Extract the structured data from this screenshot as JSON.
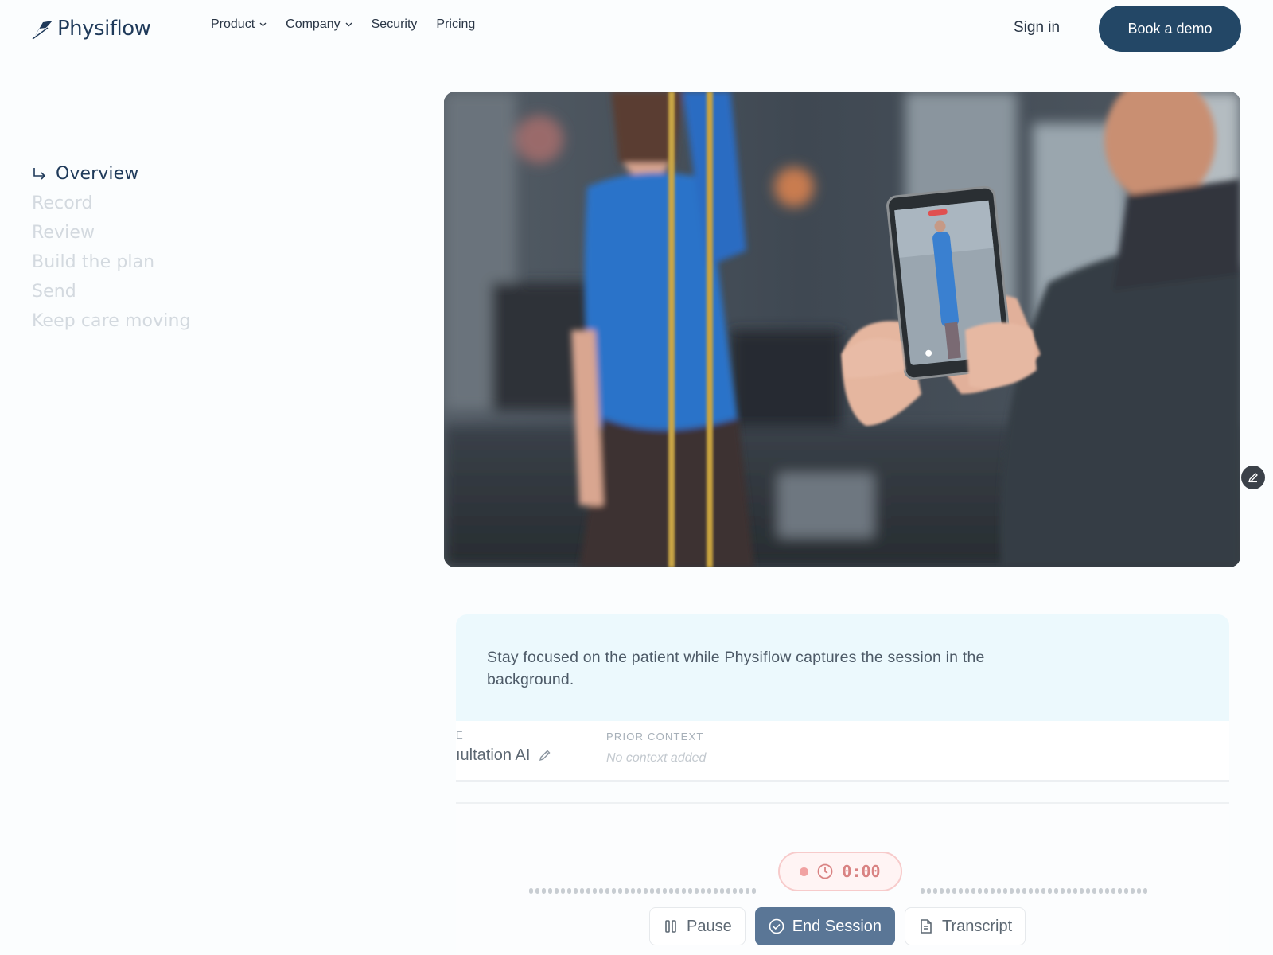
{
  "header": {
    "brand": "Physiflow",
    "nav": [
      {
        "label": "Product",
        "dropdown": true
      },
      {
        "label": "Company",
        "dropdown": true
      },
      {
        "label": "Security",
        "dropdown": false
      },
      {
        "label": "Pricing",
        "dropdown": false
      }
    ],
    "sign_in": "Sign in",
    "cta": "Book a demo"
  },
  "steps": {
    "active": "Overview",
    "items": [
      "Record",
      "Review",
      "Build the plan",
      "Send",
      "Keep care moving"
    ]
  },
  "caption": "Stay focused on the patient while Physiflow captures the session in the background.",
  "session": {
    "left_label": "E",
    "left_value": "ıultation AI",
    "prior_label": "PRIOR CONTEXT",
    "prior_value": "No context added",
    "timer": "0:00",
    "controls": {
      "pause": "Pause",
      "end": "End Session",
      "transcript": "Transcript"
    }
  },
  "colors": {
    "brand": "#1f3a5a",
    "cta_bg": "#234766",
    "caption_bg": "#ecf9fd",
    "primary_btn": "#5a7696",
    "record_accent": "#d98383"
  },
  "icons": [
    "logo-mark-icon",
    "chevron-down-icon",
    "return-arrow-icon",
    "edit-icon",
    "pencil-icon",
    "clock-icon",
    "pause-icon",
    "check-circle-icon",
    "document-icon"
  ]
}
